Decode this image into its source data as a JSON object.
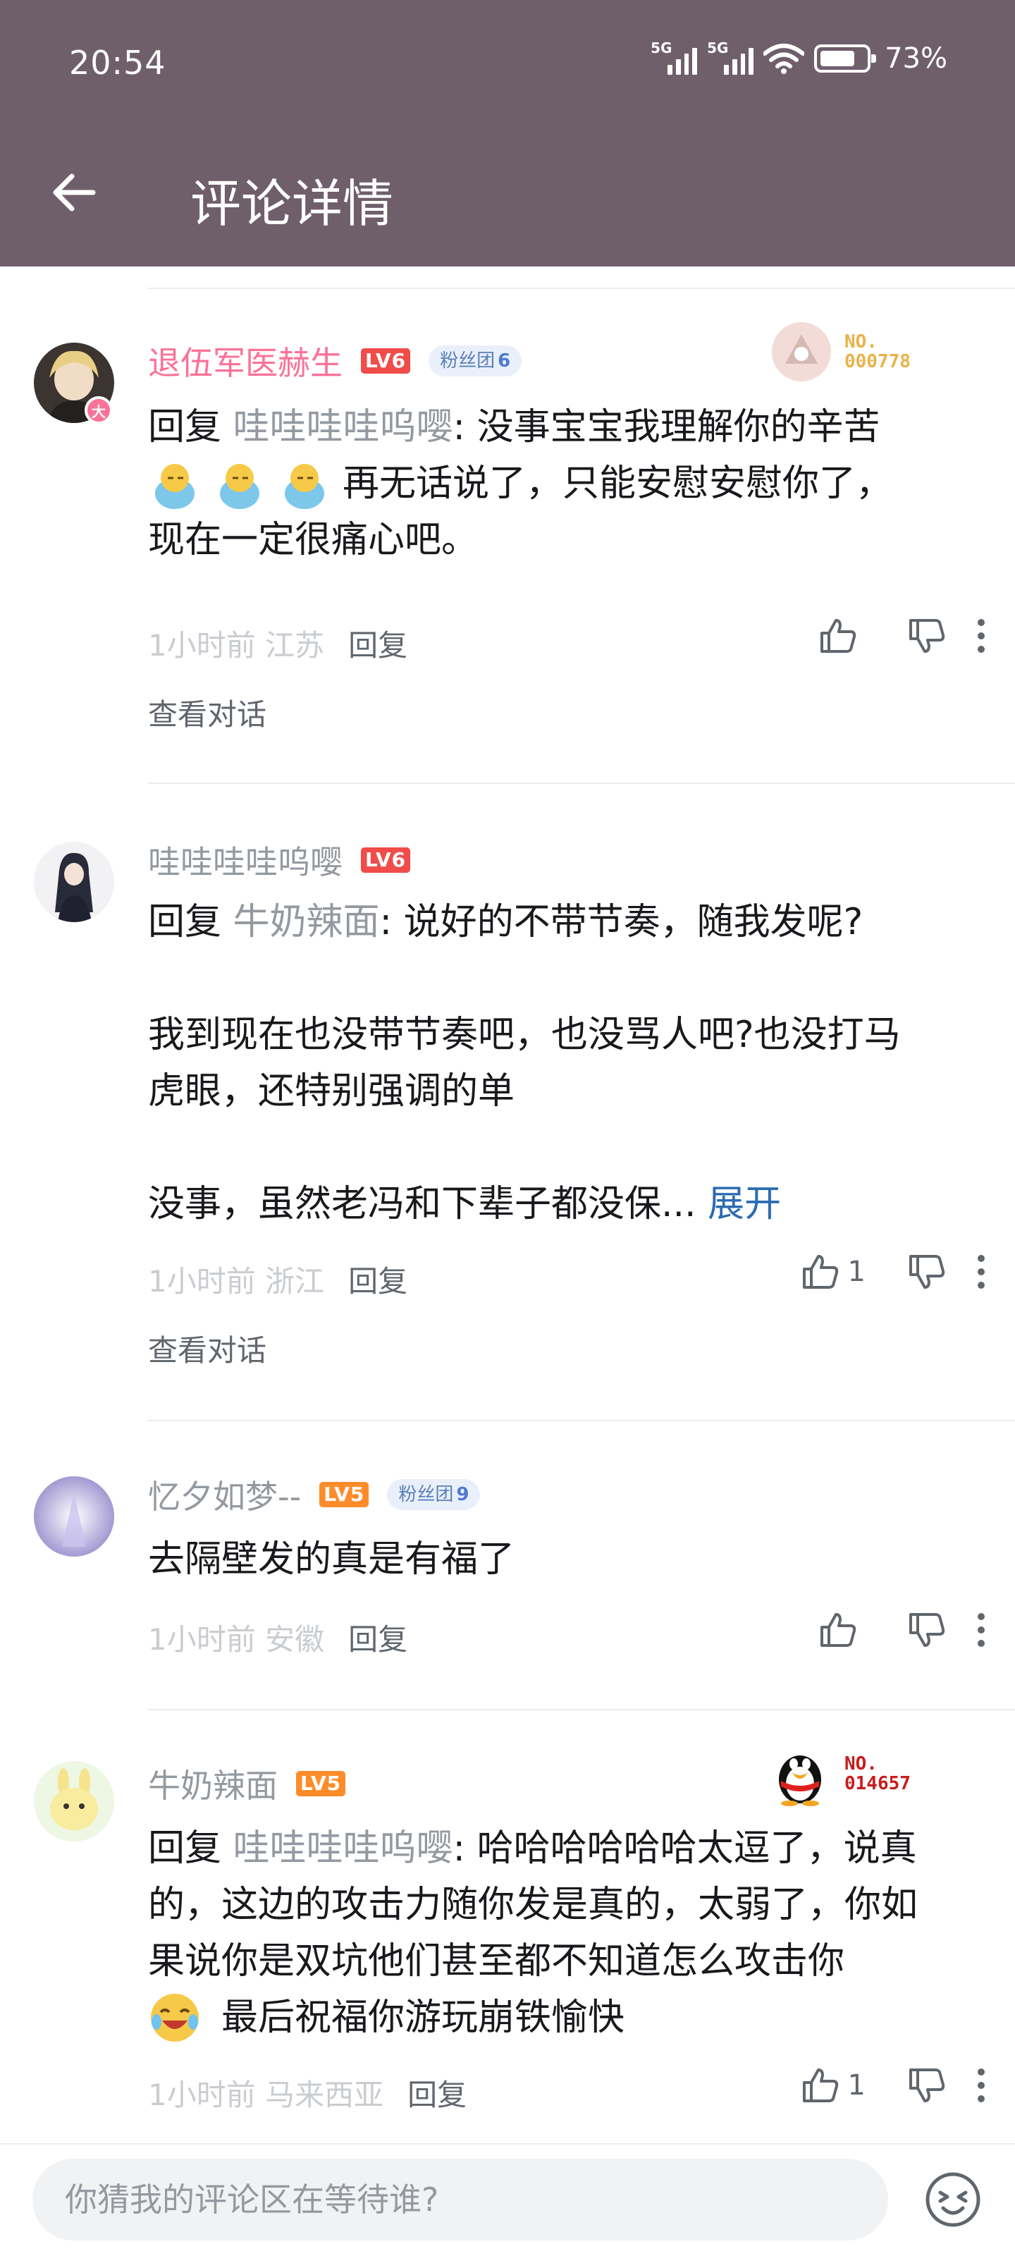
{
  "status_bar": {
    "time": "20:54",
    "signal1_label": "5G",
    "signal2_label": "5G",
    "battery": "73%"
  },
  "nav": {
    "title": "评论详情"
  },
  "comments": [
    {
      "user": "退伍军医赫生",
      "level": "LV6",
      "fan_club": "粉丝团",
      "fan_level": "6",
      "avatar_badge": "大",
      "deco_number": "NO.\n000778",
      "reply_prefix": "回复 ",
      "reply_to": "哇哇哇哇呜嘤",
      "text1": ": 没事宝宝我理解你的辛苦",
      "text2": "再无话说了，只能安慰安慰你了，",
      "text3": "现在一定很痛心吧。",
      "time": "1小时前",
      "location": "江苏",
      "reply_label": "回复",
      "likes": "",
      "view_convo": "查看对话"
    },
    {
      "user": "哇哇哇哇呜嘤",
      "level": "LV6",
      "reply_prefix": "回复 ",
      "reply_to": "牛奶辣面",
      "text1": ": 说好的不带节奏，随我发呢?",
      "text2": "我到现在也没带节奏吧，也没骂人吧?也没打马",
      "text3": "虎眼，还特别强调的单",
      "text4": "没事，虽然老冯和下辈子都没保...",
      "expand": "展开",
      "time": "1小时前",
      "location": "浙江",
      "reply_label": "回复",
      "likes": "1",
      "view_convo": "查看对话"
    },
    {
      "user": "忆夕如梦--",
      "level": "LV5",
      "fan_club": "粉丝团",
      "fan_level": "9",
      "text1": "去隔壁发的真是有福了",
      "time": "1小时前",
      "location": "安徽",
      "reply_label": "回复",
      "likes": ""
    },
    {
      "user": "牛奶辣面",
      "level": "LV5",
      "deco_number": "NO.\n014657",
      "reply_prefix": "回复 ",
      "reply_to": "哇哇哇哇呜嘤",
      "text1": ": 哈哈哈哈哈哈太逗了，说真",
      "text2": "的，这边的攻击力随你发是真的，太弱了，你如",
      "text3": "果说你是双坑他们甚至都不知道怎么攻击你",
      "text4": "最后祝福你游玩崩铁愉快",
      "time": "1小时前",
      "location": "马来西亚",
      "reply_label": "回复",
      "likes": "1"
    }
  ],
  "footer": {
    "placeholder": "你猜我的评论区在等待谁?"
  },
  "colors": {
    "header": "#6f5f6b",
    "vip_name": "#fb7299",
    "link": "#2b6cb0"
  }
}
